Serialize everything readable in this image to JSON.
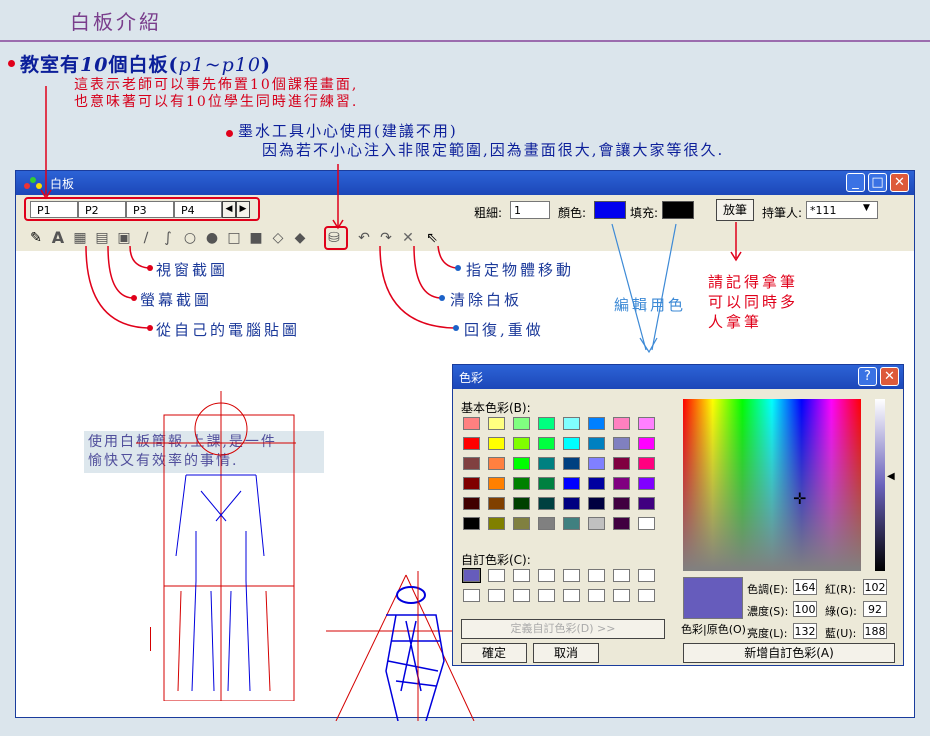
{
  "slide": {
    "title": "白板介紹",
    "bullet1": {
      "prefix": "教室有",
      "num": "10",
      "suffix": "個白板(",
      "range": "p1~p10",
      "close": ")"
    },
    "bullet1_desc": [
      "這表示老師可以事先佈置10個課程畫面,",
      "也意味著可以有10位學生同時進行練習."
    ],
    "bullet2": "墨水工具小心使用(建議不用)",
    "bullet2_desc": "因為若不小心注入非限定範圍,因為畫面很大,會讓大家等很久.",
    "annotations": {
      "window_capture": "視窗截圖",
      "screen_capture": "螢幕截圖",
      "paste_from_pc": "從自己的電腦貼圖",
      "move_object": "指定物體移動",
      "clear_board": "清除白板",
      "undo_redo": "回復,重做",
      "edit_color": "編輯用色",
      "take_pen": "請記得拿筆\n可以同時多\n人拿筆"
    },
    "canvas_note": "使用白板簡報,上課,是一件\n愉快又有效率的事情."
  },
  "window": {
    "title": "白板",
    "tabs": [
      "P1",
      "P2",
      "P3",
      "P4"
    ],
    "thickness_label": "粗細:",
    "thickness_value": "1",
    "color_label": "顏色:",
    "fill_label": "填充:",
    "pen_button": "放筆",
    "pen_holder_label": "持筆人:",
    "pen_holder_value": "*111",
    "colors": {
      "stroke": "#0000ee",
      "fill": "#000000"
    }
  },
  "color_dialog": {
    "title": "色彩",
    "basic_label": "基本色彩(B):",
    "custom_label": "自訂色彩(C):",
    "define_button": "定義自訂色彩(D) >>",
    "ok": "確定",
    "cancel": "取消",
    "preview_label": "色彩|原色(O)",
    "hue_label": "色調(E):",
    "hue": "164",
    "sat_label": "濃度(S):",
    "sat": "100",
    "lum_label": "亮度(L):",
    "lum": "132",
    "red_label": "紅(R):",
    "red": "102",
    "green_label": "綠(G):",
    "green": "92",
    "blue_label": "藍(U):",
    "blue": "188",
    "add_button": "新增自訂色彩(A)",
    "selected_color": "#665cbc",
    "basic_colors": [
      "#ff8080",
      "#ffff80",
      "#80ff80",
      "#00ff80",
      "#80ffff",
      "#0080ff",
      "#ff80c0",
      "#ff80ff",
      "#ff0000",
      "#ffff00",
      "#80ff00",
      "#00ff40",
      "#00ffff",
      "#0080c0",
      "#8080c0",
      "#ff00ff",
      "#804040",
      "#ff8040",
      "#00ff00",
      "#008080",
      "#004080",
      "#8080ff",
      "#800040",
      "#ff0080",
      "#800000",
      "#ff8000",
      "#008000",
      "#008040",
      "#0000ff",
      "#0000a0",
      "#800080",
      "#8000ff",
      "#400000",
      "#804000",
      "#004000",
      "#004040",
      "#000080",
      "#000040",
      "#400040",
      "#400080",
      "#000000",
      "#808000",
      "#808040",
      "#808080",
      "#408080",
      "#c0c0c0",
      "#400040",
      "#ffffff"
    ]
  }
}
